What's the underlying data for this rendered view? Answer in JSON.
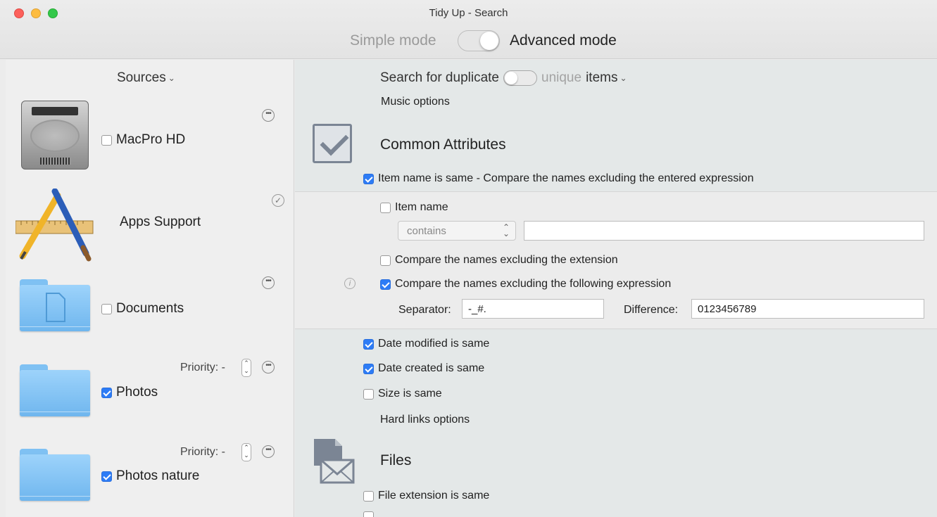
{
  "window": {
    "title": "Tidy Up - Search",
    "simple_mode_label": "Simple mode",
    "advanced_mode_label": "Advanced mode",
    "advanced_mode_on": true
  },
  "sidebar": {
    "header": "Sources",
    "sources": [
      {
        "label": "MacPro HD",
        "checked": false,
        "icon": "hard-drive-icon",
        "action": "more-icon"
      },
      {
        "label": "Apps Support",
        "checked": null,
        "icon": "applications-icon",
        "action": "checkmark-icon"
      },
      {
        "label": "Documents",
        "checked": false,
        "icon": "documents-folder-icon",
        "action": "more-icon"
      },
      {
        "label": "Photos",
        "checked": true,
        "icon": "folder-icon",
        "action": "more-icon",
        "priority": "Priority: -"
      },
      {
        "label": "Photos nature",
        "checked": true,
        "icon": "folder-icon",
        "action": "more-icon",
        "priority": "Priority: -"
      }
    ]
  },
  "search": {
    "prefix": "Search for duplicate",
    "unique": "unique",
    "items": "items",
    "music_options": "Music options"
  },
  "common": {
    "title": "Common Attributes",
    "item_name_same": "Item name is same - Compare the names excluding the entered expression",
    "item_name": "Item name",
    "contains": "contains",
    "excl_extension": "Compare the names excluding the extension",
    "excl_expression": "Compare the names excluding the following expression",
    "separator_label": "Separator:",
    "separator_value": "-_#.",
    "difference_label": "Difference:",
    "difference_value": "0123456789",
    "date_modified": "Date modified is same",
    "date_created": "Date created is same",
    "size_same": "Size is same",
    "hard_links": "Hard links options"
  },
  "files": {
    "title": "Files",
    "ext_same": "File extension is same"
  },
  "colors": {
    "accent": "#2d7cf6",
    "folder": "#7fc1f3"
  }
}
